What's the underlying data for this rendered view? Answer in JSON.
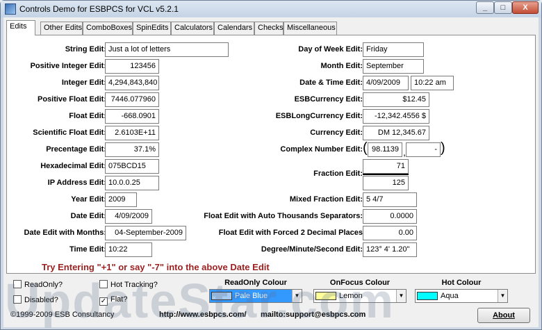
{
  "window": {
    "title": "Controls Demo for ESBPCS for VCL v5.2.1",
    "min_label": "_",
    "max_label": "□",
    "close_label": "X"
  },
  "tabs": [
    "Edits",
    "Other Edits",
    "ComboBoxes",
    "SpinEdits",
    "Calculators",
    "Calendars",
    "Checks",
    "Miscellaneous"
  ],
  "left_fields": [
    {
      "label": "String Edit:",
      "value": "Just a lot of letters"
    },
    {
      "label": "Positive Integer Edit:",
      "value": "123456"
    },
    {
      "label": "Integer Edit:",
      "value": "4,294,843,840"
    },
    {
      "label": "Positive Float Edit:",
      "value": "7446.077960"
    },
    {
      "label": "Float Edit:",
      "value": "-668.0901"
    },
    {
      "label": "Scientific Float Edit:",
      "value": "2.6103E+11"
    },
    {
      "label": "Precentage Edit:",
      "value": "37.1%"
    },
    {
      "label": "Hexadecimal Edit:",
      "value": "075BCD15"
    },
    {
      "label": "IP Address Edit:",
      "value": "10.0.0.25"
    },
    {
      "label": "Year Edit:",
      "value": "2009"
    },
    {
      "label": "Date Edit:",
      "value": "4/09/2009"
    },
    {
      "label": "Date Edit with Months:",
      "value": "04-September-2009"
    },
    {
      "label": "Time Edit:",
      "value": "10:22"
    }
  ],
  "right_fields": {
    "day_of_week": {
      "label": "Day of Week Edit:",
      "value": "Friday"
    },
    "month": {
      "label": "Month Edit:",
      "value": "September"
    },
    "date_time": {
      "label": "Date & Time Edit:",
      "date": "4/09/2009",
      "time": "10:22 am"
    },
    "esb_currency": {
      "label": "ESBCurrency Edit:",
      "value": "$12.45"
    },
    "esb_long_currency": {
      "label": "ESBLongCurrency Edit:",
      "value": "-12,342.4556 $"
    },
    "currency": {
      "label": "Currency Edit:",
      "value": "DM 12,345.67"
    },
    "complex": {
      "label": "Complex Number Edit:",
      "real": "98.1139",
      "imag": "-",
      "open_paren": "(",
      "close_paren": ")",
      "separator": ","
    },
    "fraction": {
      "label": "Fraction Edit:",
      "numerator": "71",
      "denominator": "125"
    },
    "mixed_fraction": {
      "label": "Mixed Fraction Edit:",
      "value": "5 4/7"
    },
    "float_thousands": {
      "label": "Float Edit with Auto Thousands Separators:",
      "value": "0.0000"
    },
    "float_forced": {
      "label": "Float Edit with Forced 2 Decimal Places",
      "value": "0.00"
    },
    "dms": {
      "label": "Degree/Minute/Second Edit:",
      "value": "123° 4' 1.20\""
    }
  },
  "hint": "Try Entering  \"+1\" or say \"-7\" into the above Date Edit",
  "options": {
    "readonly": {
      "label": "ReadOnly?",
      "checked": false
    },
    "disabled": {
      "label": "Disabled?",
      "checked": false
    },
    "hot_tracking": {
      "label": "Hot Tracking?",
      "checked": false
    },
    "flat": {
      "label": "Flat?",
      "checked": true
    }
  },
  "colours": {
    "readonly": {
      "label": "ReadOnly Colour",
      "value": "Pale Blue",
      "swatch": "#a6caf0"
    },
    "onfocus": {
      "label": "OnFocus Colour",
      "value": "Lemon",
      "swatch": "#ffff99"
    },
    "hot": {
      "label": "Hot Colour",
      "value": "Aqua",
      "swatch": "#00ffff"
    }
  },
  "footer": {
    "copyright": "©1999-2009 ESB Consultancy",
    "website": "http://www.esbpcs.com/",
    "email": "mailto:support@esbpcs.com",
    "about_label": "About",
    "check_mark": "✓",
    "combo_arrow": "▼"
  },
  "watermark": "UpdateStar.com"
}
